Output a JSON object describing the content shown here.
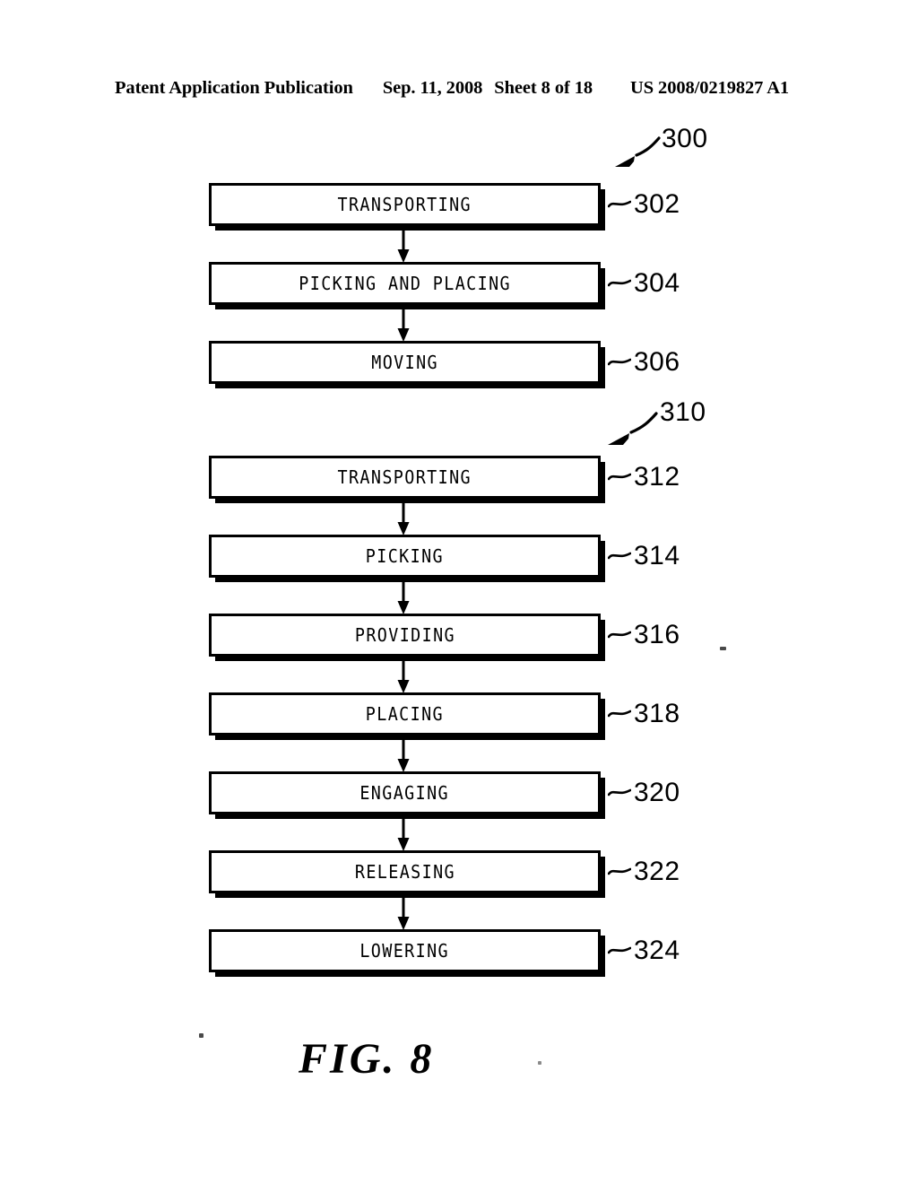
{
  "header": {
    "publication": "Patent Application Publication",
    "date": "Sep. 11, 2008",
    "sheet": "Sheet 8 of 18",
    "patent_number": "US 2008/0219827 A1"
  },
  "figure": {
    "caption": "FIG. 8",
    "groups": [
      {
        "callout_number": "300",
        "steps": [
          {
            "label": "TRANSPORTING",
            "ref": "302"
          },
          {
            "label": "PICKING AND PLACING",
            "ref": "304"
          },
          {
            "label": "MOVING",
            "ref": "306"
          }
        ]
      },
      {
        "callout_number": "310",
        "steps": [
          {
            "label": "TRANSPORTING",
            "ref": "312"
          },
          {
            "label": "PICKING",
            "ref": "314"
          },
          {
            "label": "PROVIDING",
            "ref": "316"
          },
          {
            "label": "PLACING",
            "ref": "318"
          },
          {
            "label": "ENGAGING",
            "ref": "320"
          },
          {
            "label": "RELEASING",
            "ref": "322"
          },
          {
            "label": "LOWERING",
            "ref": "324"
          }
        ]
      }
    ]
  }
}
